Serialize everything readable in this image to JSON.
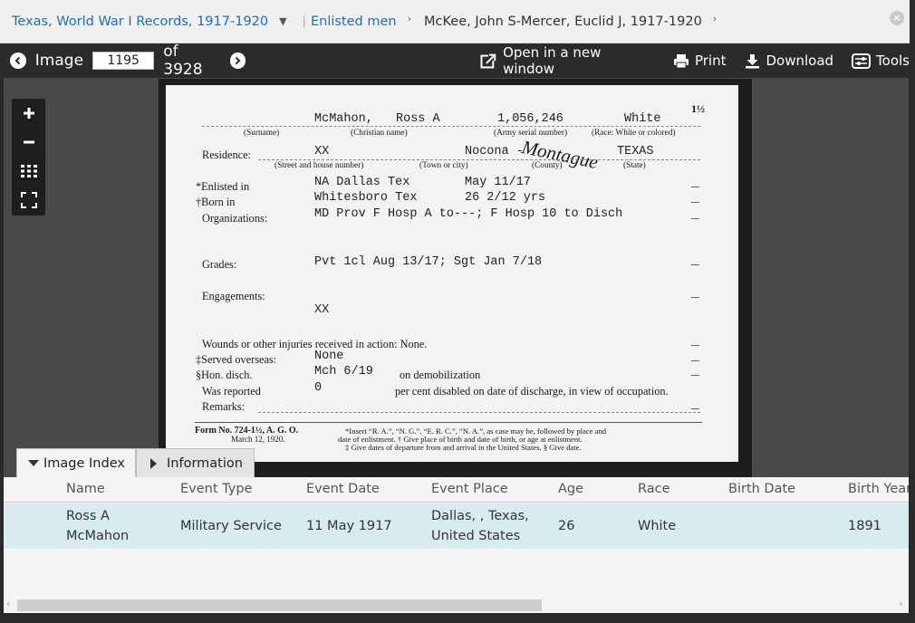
{
  "breadcrumb": {
    "collection": "Texas, World War I Records, 1917-1920",
    "subset": "Enlisted men",
    "range": "McKee, John S-Mercer, Euclid J, 1917-1920"
  },
  "close_symbol": "×",
  "toolbar": {
    "image_label": "Image",
    "image_number": "1195",
    "of_total": "of 3928",
    "open_new_window": "Open in a new window",
    "print": "Print",
    "download": "Download",
    "tools": "Tools"
  },
  "card": {
    "corner": "1½",
    "surname": "McMahon,",
    "given": "Ross A",
    "serial": "1,056,246",
    "race": "White",
    "cap_surname": "(Surname)",
    "cap_christian": "(Christian name)",
    "cap_serial": "(Army serial number)",
    "cap_race": "(Race: White or colored)",
    "residence_label": "Residence:",
    "residence_street": "XX",
    "residence_town": "Nocona -",
    "residence_county_hw": "Montague",
    "residence_state": "TEXAS",
    "cap_street": "(Street and house number)",
    "cap_town": "(Town or city)",
    "cap_county": "(County)",
    "cap_state": "(State)",
    "enlisted_label": "*Enlisted in",
    "enlisted_value": "NA Dallas Tex",
    "enlisted_date": "May 11/17",
    "born_label": "†Born in",
    "born_value": "Whitesboro Tex",
    "born_age": "26 2/12 yrs",
    "org_label": "Organizations:",
    "org_value": "MD Prov F Hosp A to---; F Hosp 10 to Disch",
    "grades_label": "Grades:",
    "grades_value": "Pvt 1cl Aug 13/17; Sgt Jan 7/18",
    "engagements_label": "Engagements:",
    "engagements_value": "XX",
    "wounds_label": "Wounds or other injuries received in action: None.",
    "served_label": "‡Served overseas:",
    "served_value": "None",
    "hon_label": "§Hon. disch.",
    "hon_value": "Mch 6/19",
    "hon_note": "on demobilization",
    "reported_label": "Was reported",
    "reported_value": "0",
    "reported_note": "per cent disabled on date of discharge, in view of occupation.",
    "remarks_label": "Remarks:",
    "form_line1": "Form No. 724-1½, A. G. O.",
    "form_line2": "March 12, 1920.",
    "foot_line1": "*Insert “R. A.”, “N. G.”, “E. R. C.”, “N. A.”, as case may be, followed by place and",
    "foot_line2": "date of enlistment.        † Give place of birth and date of birth, or age at enlistment.",
    "foot_line3": "‡ Give dates of departure from and arrival in the United States.   § Give date."
  },
  "tabs": {
    "index": "Image Index",
    "information": "Information"
  },
  "index_table": {
    "columns": [
      "Name",
      "Event Type",
      "Event Date",
      "Event Place",
      "Age",
      "Race",
      "Birth Date",
      "Birth Year"
    ],
    "row": {
      "name_line1": "Ross A",
      "name_line2": "McMahon",
      "event_type": "Military Service",
      "event_date": "11 May 1917",
      "place_line1": "Dallas, , Texas,",
      "place_line2": "United States",
      "age": "26",
      "race": "White",
      "birth_date": "",
      "birth_year": "1891"
    }
  },
  "colors": {
    "link": "#1f6fb5",
    "toolbar_bg": "#2b2b2b",
    "selected_row": "#d8ebee"
  }
}
